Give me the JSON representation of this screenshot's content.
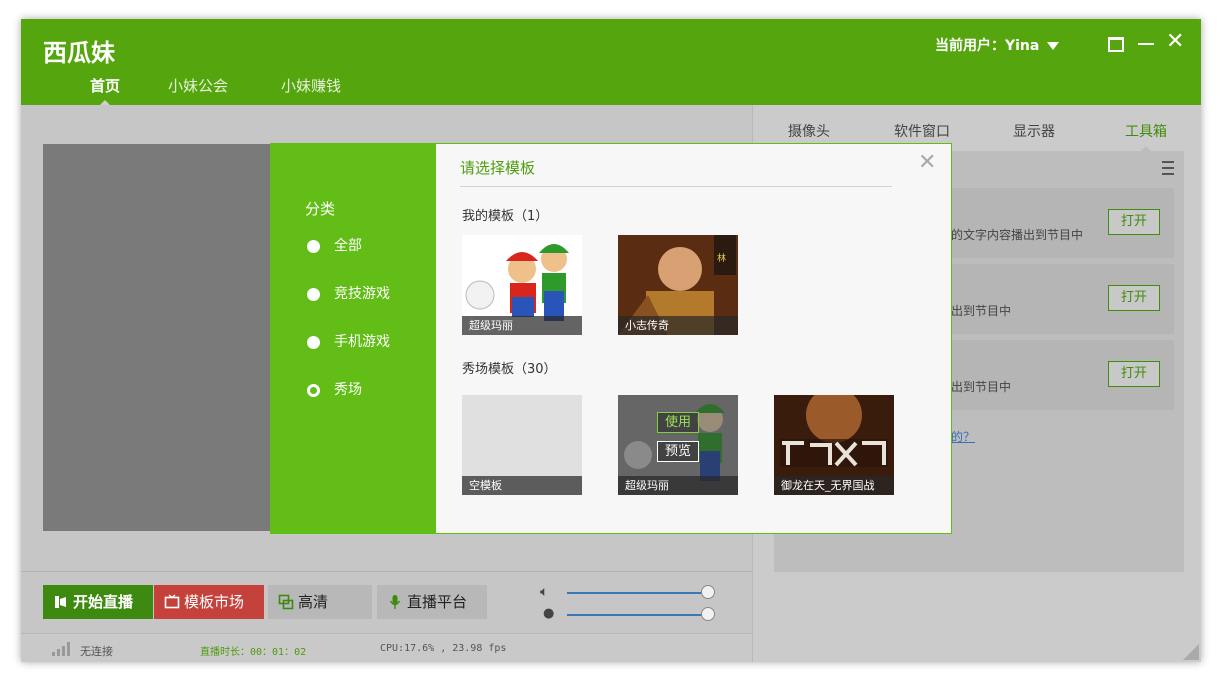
{
  "app": {
    "logo": "西瓜妹",
    "user_label": "当前用户：Yina",
    "nav_tabs": [
      {
        "label": "首页",
        "active": true
      },
      {
        "label": "小妹公会",
        "active": false
      },
      {
        "label": "小妹赚钱",
        "active": false
      }
    ]
  },
  "right_panel": {
    "tabs": [
      {
        "label": "摄像头",
        "active": false
      },
      {
        "label": "软件窗口",
        "active": false
      },
      {
        "label": "显示器",
        "active": false
      },
      {
        "label": "工具箱",
        "active": true
      }
    ],
    "tools": [
      {
        "desc": "的文字内容播出到节目中",
        "button": "打开"
      },
      {
        "desc": "出到节目中",
        "button": "打开"
      },
      {
        "desc": "出到节目中",
        "button": "打开"
      }
    ],
    "help_link": "的？"
  },
  "bottom_toolbar": {
    "start": "开始直播",
    "market": "模板市场",
    "hd": "高清",
    "platform": "直播平台",
    "speaker_volume": 0.98,
    "mic_volume": 0.98
  },
  "status": {
    "connection": "无连接",
    "duration": "直播时长：00：01：02",
    "perf": "CPU:17.6% , 23.98 fps"
  },
  "modal": {
    "side_title": "分类",
    "categories": [
      {
        "label": "全部",
        "selected": false
      },
      {
        "label": "竞技游戏",
        "selected": false
      },
      {
        "label": "手机游戏",
        "selected": false
      },
      {
        "label": "秀场",
        "selected": true
      }
    ],
    "title": "请选择模板",
    "my_section": "我的模板（1）",
    "my_templates": [
      {
        "caption": "超级玛丽"
      },
      {
        "caption": "小志传奇"
      }
    ],
    "show_section": "秀场模板（30）",
    "show_templates": [
      {
        "caption": "空模板"
      },
      {
        "caption": "超级玛丽",
        "use": "使用",
        "preview": "预览"
      },
      {
        "caption": "御龙在天_无界国战"
      }
    ]
  },
  "colors": {
    "brand_green": "#55a50e",
    "side_green": "#62bd17",
    "market_red": "#c4423b"
  }
}
